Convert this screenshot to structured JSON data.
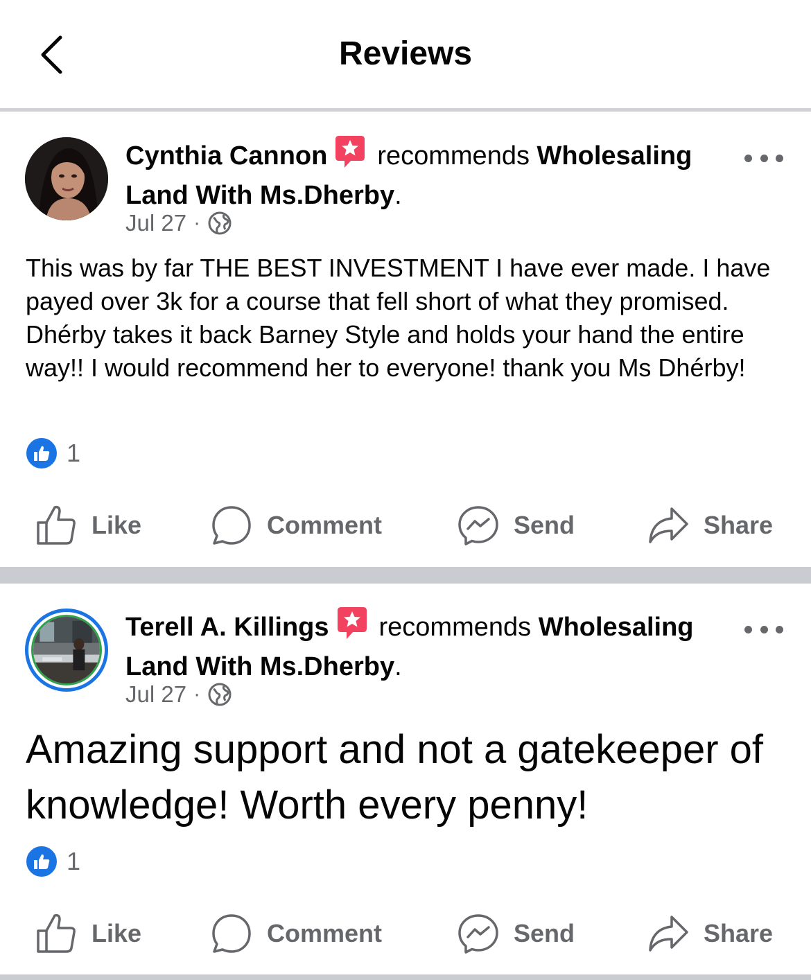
{
  "header": {
    "title": "Reviews"
  },
  "reviews": [
    {
      "author": "Cynthia Cannon",
      "verb": "recommends",
      "page": "Wholesaling Land With Ms.Dherby",
      "date": "Jul 27",
      "separator": "·",
      "text": "This was by far THE BEST INVESTMENT  I have ever made. I have payed over 3k for a course that fell short of what they promised. Dhérby takes it back Barney Style and holds your hand the entire way!! I would recommend her to everyone! thank you Ms Dhérby!",
      "like_count": "1"
    },
    {
      "author": "Terell A. Killings",
      "verb": "recommends",
      "page": "Wholesaling Land With Ms.Dherby",
      "date": "Jul 27",
      "separator": "·",
      "text": "Amazing support and not a gatekeeper of knowledge! Worth every penny!",
      "like_count": "1"
    }
  ],
  "actions": {
    "like": "Like",
    "comment": "Comment",
    "send": "Send",
    "share": "Share"
  },
  "colors": {
    "accent": "#1b74e4",
    "recommend_badge": "#f3425f",
    "secondary_text": "#65676b",
    "separator": "#c9ccd1"
  },
  "icons": [
    "back-chevron-icon",
    "recommend-badge-icon",
    "more-icon",
    "globe-icon",
    "like-badge-icon",
    "like-icon",
    "comment-icon",
    "messenger-icon",
    "share-icon"
  ]
}
